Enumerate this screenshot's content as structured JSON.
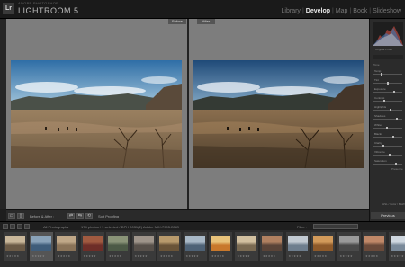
{
  "app": {
    "logo": "Lr",
    "subtitle": "ADOBE PHOTOSHOP",
    "title": "LIGHTROOM 5"
  },
  "modules": [
    "Library",
    "Develop",
    "Map",
    "Book",
    "Slideshow"
  ],
  "active_module": "Develop",
  "canvas": {
    "before_label": "Before",
    "after_label": "After"
  },
  "right_panel": {
    "histogram_caption": "Original Photo",
    "sections": [
      "Tone",
      "Presence"
    ],
    "sliders": [
      "Temp",
      "Tint",
      "Exposure",
      "Contrast",
      "Highlights",
      "Shadows",
      "Whites",
      "Blacks",
      "Clarity",
      "Vibrance",
      "Saturation"
    ],
    "hsl_label": "HSL / Color / B&W",
    "previous_label": "Previous"
  },
  "toolbar": {
    "mode_label": "Before & After :",
    "soft_proofing_label": "Soft Proofing"
  },
  "filmstrip": {
    "source_label": "All Photographs",
    "status_text": "174 photos / 1 selected / DPH 0031(2) Adobe MIX-7995.DNG",
    "filter_label": "Filter :",
    "thumb_count": 16,
    "selected_index": 1,
    "thumb_stars": "★★★★★"
  },
  "colors": {
    "sky_top": "#2f6ea6",
    "sky_bottom": "#8fb5d0",
    "ground": "#8a7050",
    "canvas_bg": "#7d7d7d",
    "panel_bg": "#2b2b2b"
  }
}
